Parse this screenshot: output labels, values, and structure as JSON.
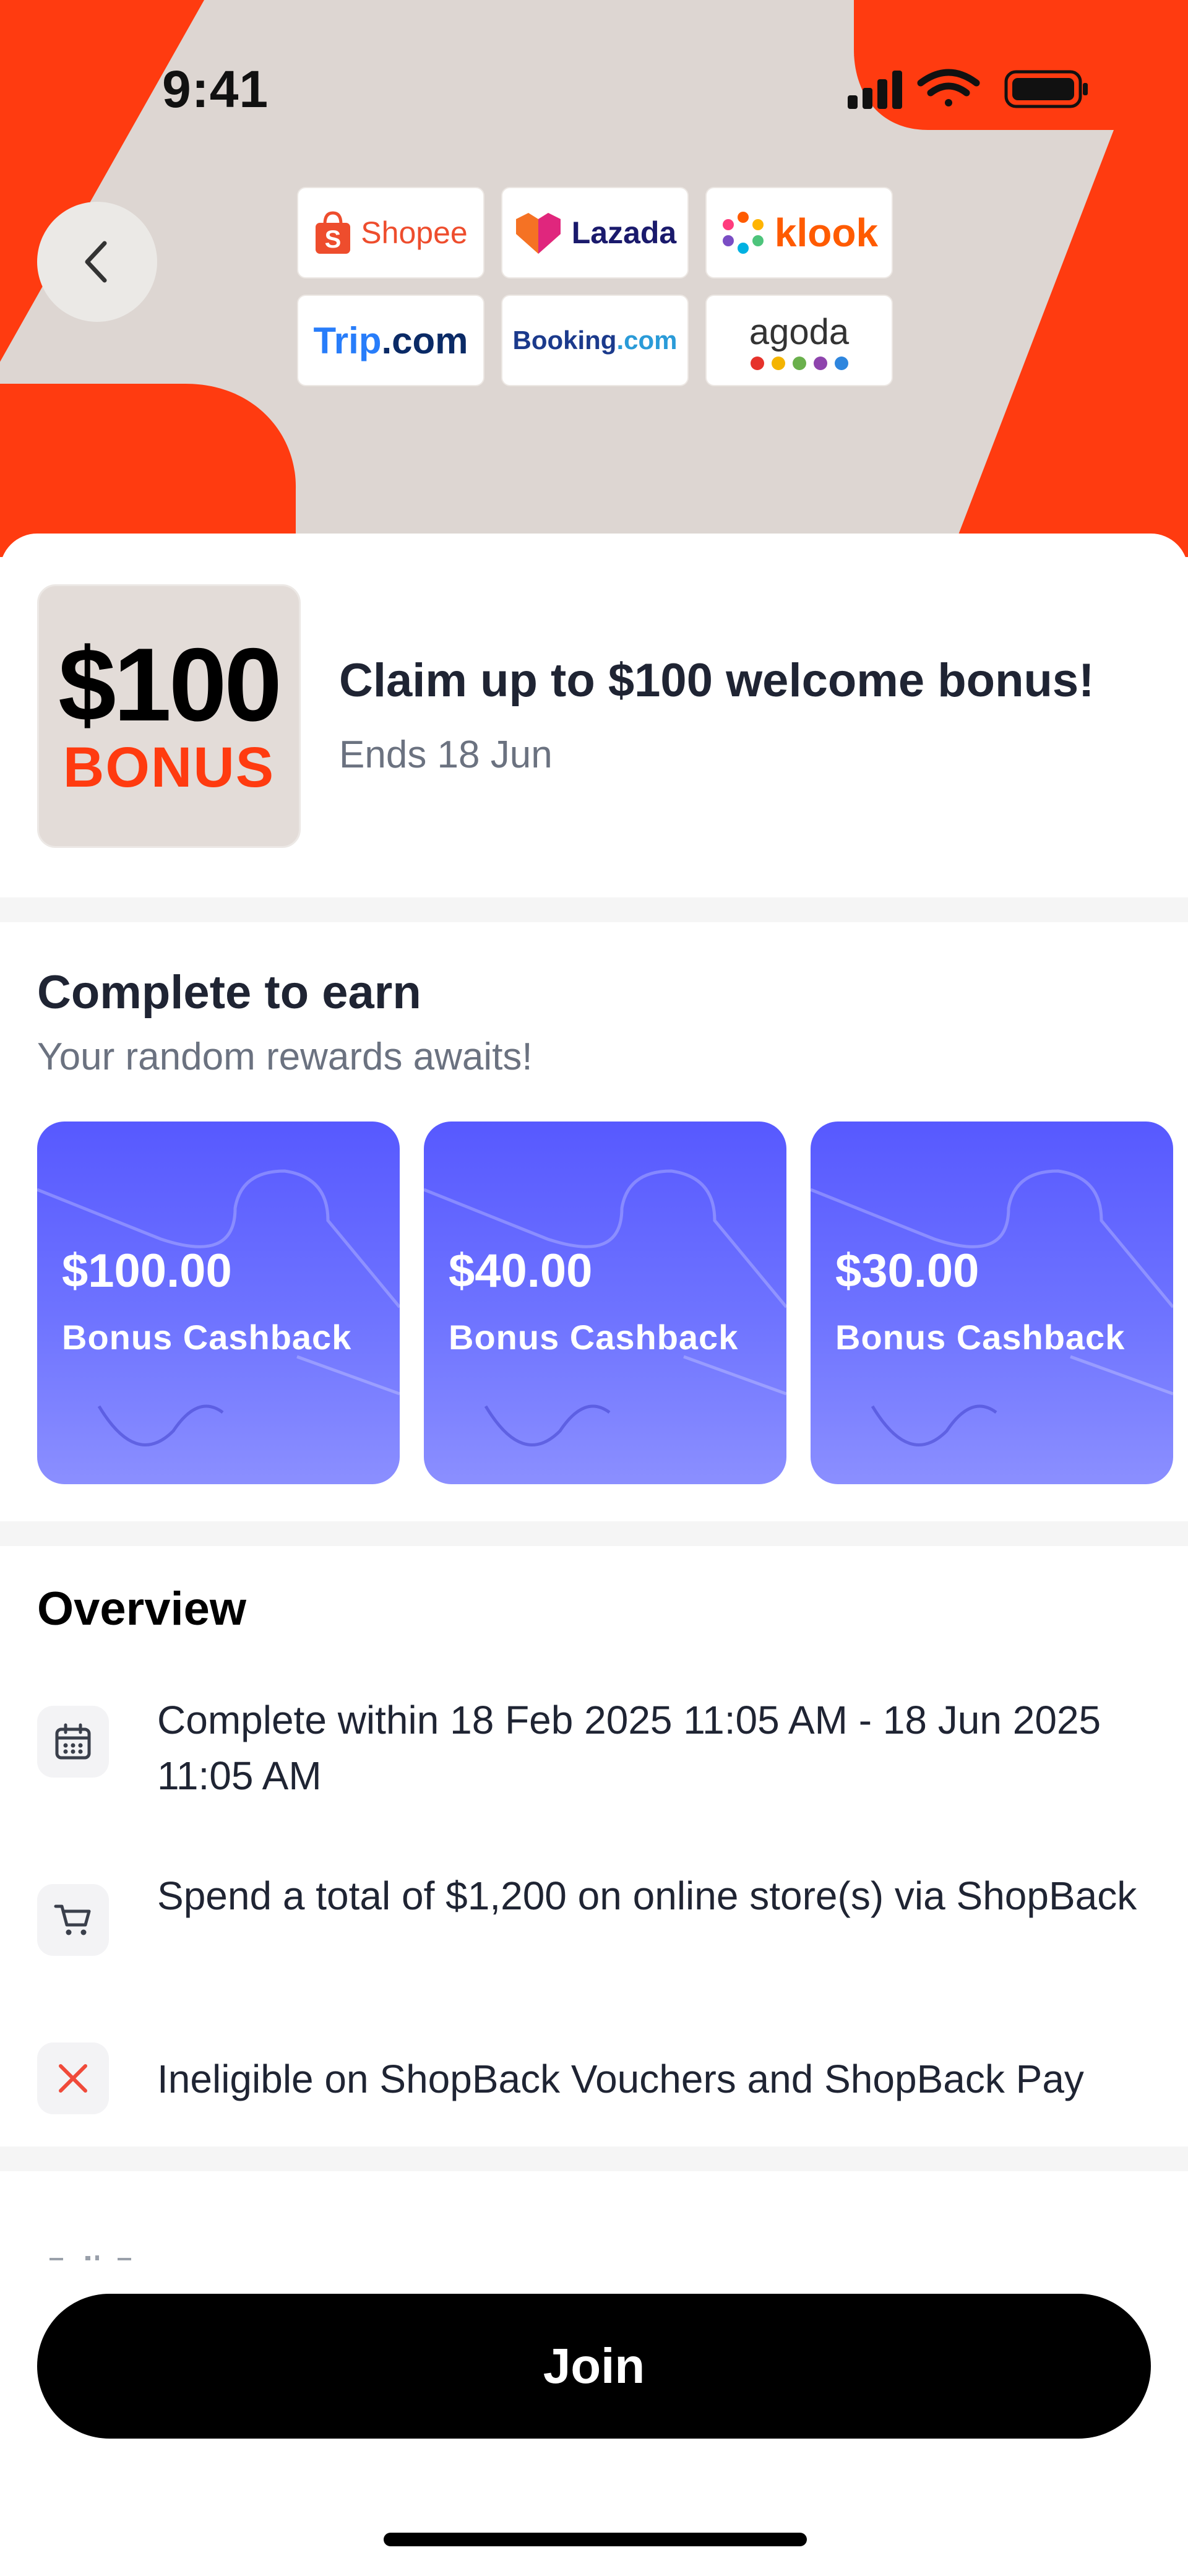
{
  "status_bar": {
    "time": "9:41"
  },
  "hero": {
    "partners": {
      "shopee": "Shopee",
      "lazada": "Lazada",
      "klook": "klook",
      "trip_main": "Trip",
      "trip_dot": ".com",
      "booking_main": "Booking",
      "booking_dot": ".com",
      "agoda": "agoda"
    },
    "agoda_dot_colors": [
      "#e6322b",
      "#f4b400",
      "#6ab04c",
      "#8e44ad",
      "#2e86de"
    ]
  },
  "campaign": {
    "badge_amount": "$100",
    "badge_word": "BONUS",
    "title": "Claim up to $100 welcome bonus!",
    "ends": "Ends 18 Jun"
  },
  "earn": {
    "title": "Complete to earn",
    "subtitle": "Your random rewards awaits!",
    "rewards": [
      {
        "amount": "$100.00",
        "label": "Bonus Cashback"
      },
      {
        "amount": "$40.00",
        "label": "Bonus Cashback"
      },
      {
        "amount": "$30.00",
        "label": "Bonus Cashback"
      }
    ]
  },
  "overview": {
    "title": "Overview",
    "items": [
      {
        "icon": "calendar-icon",
        "text": "Complete within 18 Feb 2025 11:05 AM - 18 Jun 2025 11:05 AM"
      },
      {
        "icon": "cart-icon",
        "text": "Spend a total of $1,200 on online store(s) via ShopBack"
      },
      {
        "icon": "close-icon",
        "text": "Ineligible on ShopBack Vouchers and ShopBack Pay"
      }
    ]
  },
  "cta": {
    "join_label": "Join"
  },
  "colors": {
    "brand": "#ff3b10",
    "reward_card": "#5f63ff",
    "cta": "#000000"
  }
}
